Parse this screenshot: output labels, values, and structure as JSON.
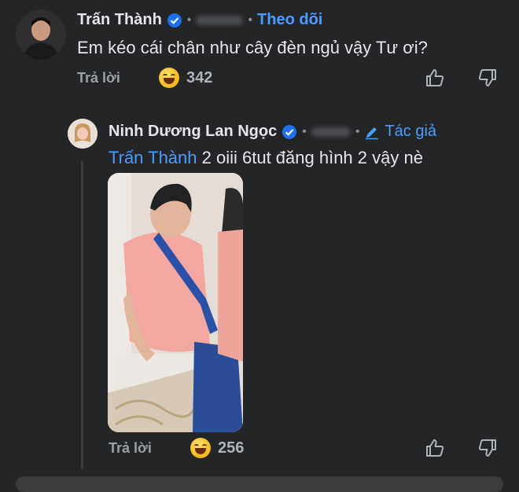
{
  "comment": {
    "author": "Trấn Thành",
    "follow_label": "Theo dõi",
    "text": "Em kéo cái chân như cây đèn ngủ vậy Tư ơi?",
    "reply_label": "Trả lời",
    "reaction_count": "342"
  },
  "reply": {
    "author": "Ninh Dương Lan Ngọc",
    "author_badge_label": "Tác giả",
    "mention": "Trấn Thành",
    "text": " 2 oiii 6tut đăng hình 2 vậy nè",
    "reply_label": "Trả lời",
    "reaction_count": "256"
  },
  "colors": {
    "background": "#242526",
    "accent": "#4a9cff",
    "verified": "#1d6ff2"
  }
}
